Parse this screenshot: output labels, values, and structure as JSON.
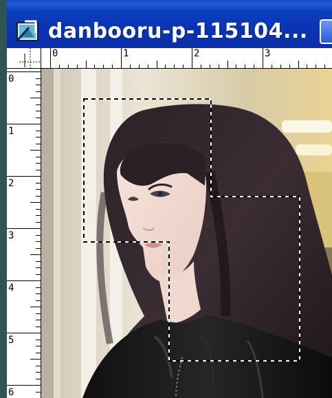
{
  "window": {
    "title": "danbooru-p-115104..."
  },
  "icons": {
    "document": "document-icon",
    "minimize": "minimize-icon"
  },
  "rulers": {
    "unit": "inches",
    "horizontal_labels": [
      "0",
      "1",
      "2",
      "3"
    ],
    "vertical_labels": [
      "0",
      "1",
      "2",
      "3",
      "4",
      "5",
      "6"
    ]
  },
  "canvas": {
    "content": "photo",
    "selection": "marquee"
  },
  "colors": {
    "titlebar": "#0a3fc0",
    "titlebar_text": "#ffffff",
    "ruler_bg": "#ffffff",
    "frame": "#d4d0c8",
    "desktop": "#2b4d4a"
  }
}
